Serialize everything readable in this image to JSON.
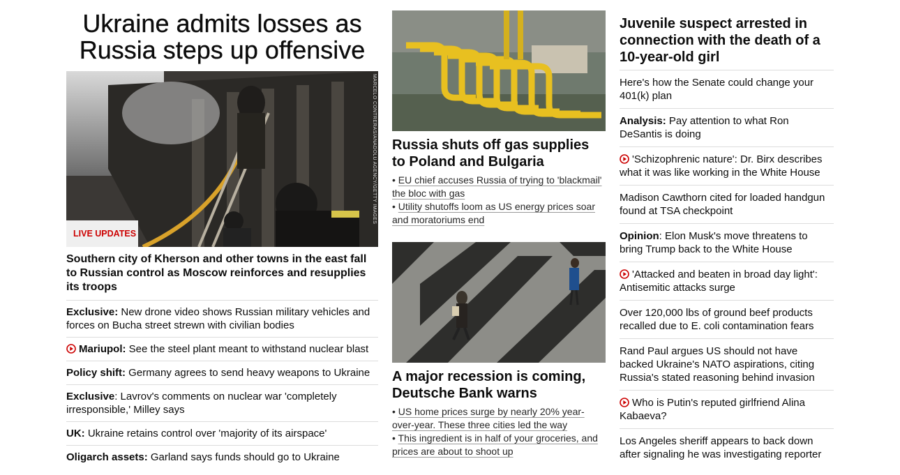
{
  "col1": {
    "headline": "Ukraine admits losses as Russia steps up offensive",
    "hero": {
      "badge": "LIVE UPDATES",
      "credit": "MARCELO CONTRERAS/ANADOLU AGENCY/GETTY IMAGES"
    },
    "lead": "Southern city of Kherson and other towns in the east fall to Russian control as Moscow reinforces and resupplies its troops",
    "items": [
      {
        "prefix": "Exclusive:",
        "text": " New drone video shows Russian military vehicles and forces on Bucha street strewn with civilian bodies",
        "video": false
      },
      {
        "prefix": "Mariupol:",
        "text": " See the steel plant meant to withstand nuclear blast",
        "video": true
      },
      {
        "prefix": "Policy shift:",
        "text": " Germany agrees to send heavy weapons to Ukraine",
        "video": false
      },
      {
        "prefix": "Exclusive",
        "text": ": Lavrov's comments on nuclear war 'completely irresponsible,' Milley says",
        "video": false
      },
      {
        "prefix": "UK:",
        "text": " Ukraine retains control over 'majority of its airspace'",
        "video": false
      },
      {
        "prefix": "Oligarch assets:",
        "text": " Garland says funds should go to Ukraine",
        "video": false
      }
    ]
  },
  "col2": {
    "card1": {
      "title": "Russia shuts off gas supplies to Poland and Bulgaria",
      "subs": [
        "EU chief accuses Russia of trying to 'blackmail' the bloc with gas",
        "Utility shutoffs loom as US energy prices soar and moratoriums end"
      ]
    },
    "card2": {
      "title": "A major recession is coming, Deutsche Bank warns",
      "subs": [
        "US home prices surge by nearly 20% year-over-year. These three cities led the way",
        "This ingredient is in half of your groceries, and prices are about to shoot up"
      ]
    }
  },
  "col3": {
    "title": "Juvenile suspect arrested in connection with the death of a 10-year-old girl",
    "items": [
      {
        "prefix": "",
        "text": "Here's how the Senate could change your 401(k) plan",
        "video": false
      },
      {
        "prefix": "Analysis:",
        "text": " Pay attention to what Ron DeSantis is doing",
        "video": false
      },
      {
        "prefix": "",
        "text": "'Schizophrenic nature': Dr. Birx describes what it was like working in the White House",
        "video": true
      },
      {
        "prefix": "",
        "text": "Madison Cawthorn cited for loaded handgun found at TSA checkpoint",
        "video": false
      },
      {
        "prefix": "Opinion",
        "text": ": Elon Musk's move threatens to bring Trump back to the White House",
        "video": false
      },
      {
        "prefix": "",
        "text": "'Attacked and beaten in broad day light': Antisemitic attacks surge",
        "video": true
      },
      {
        "prefix": "",
        "text": "Over 120,000 lbs of ground beef products recalled due to E. coli contamination fears",
        "video": false
      },
      {
        "prefix": "",
        "text": "Rand Paul argues US should not have backed Ukraine's NATO aspirations, citing Russia's stated reasoning behind invasion",
        "video": false
      },
      {
        "prefix": "",
        "text": "Who is Putin's reputed girlfriend Alina Kabaeva?",
        "video": true
      },
      {
        "prefix": "",
        "text": "Los Angeles sheriff appears to back down after signaling he was investigating reporter",
        "video": false
      }
    ]
  },
  "colors": {
    "accent": "#cc0000",
    "divider": "#dcdcdc",
    "badge_bg": "#efefef"
  },
  "icons": {
    "video": "play-circle-icon"
  }
}
